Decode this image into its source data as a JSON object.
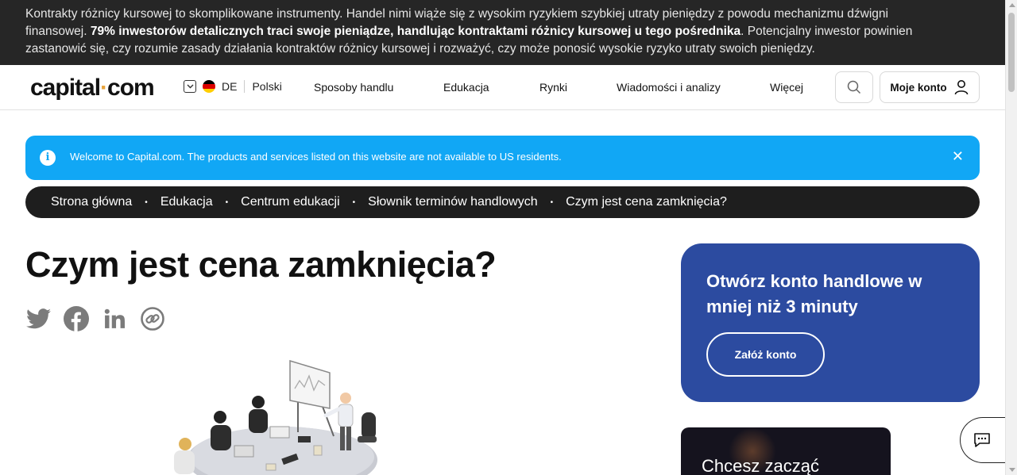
{
  "risk_banner": {
    "text_before": "Kontrakty różnicy kursowej to skomplikowane instrumenty. Handel nimi wiąże się z wysokim ryzykiem szybkiej utraty pieniędzy z powodu mechanizmu dźwigni finansowej. ",
    "text_bold": "79% inwestorów detalicznych traci swoje pieniądze, handlując kontraktami różnicy kursowej u tego pośrednika",
    "text_after": ". Potencjalny inwestor powinien zastanowić się, czy rozumie zasady działania kontraktów różnicy kursowej i rozważyć, czy może ponosić wysokie ryzyko utraty swoich pieniędzy."
  },
  "header": {
    "logo_part1": "capital",
    "logo_dot": "·",
    "logo_part2": "com",
    "region_code": "DE",
    "language": "Polski",
    "nav": [
      "Sposoby handlu",
      "Edukacja",
      "Rynki",
      "Wiadomości i analizy",
      "Więcej"
    ],
    "account_label": "Moje konto",
    "icons": {
      "search": "search-icon",
      "user": "user-icon",
      "chevron": "chevron-down-icon",
      "flag": "germany-flag-icon"
    }
  },
  "notice": {
    "text": "Welcome to Capital.com. The products and services listed on this website are not available to US residents.",
    "info_glyph": "i",
    "close_glyph": "✕",
    "color": "#11a7f5"
  },
  "breadcrumb": [
    "Strona główna",
    "Edukacja",
    "Centrum edukacji",
    "Słownik terminów handlowych",
    "Czym jest cena zamknięcia?"
  ],
  "breadcrumb_separator": "•",
  "page": {
    "title": "Czym jest cena zamknięcia?",
    "share_icons": [
      "twitter-icon",
      "facebook-icon",
      "linkedin-icon",
      "copy-link-icon"
    ]
  },
  "promo": {
    "title": "Otwórz konto handlowe w mniej niż 3 minuty",
    "button": "Załóż konto",
    "color": "#2c4ba0"
  },
  "promo2": {
    "text": "Chcesz zacząć"
  },
  "colors": {
    "risk_bg": "#262626",
    "logo_dot": "#e8a23a",
    "breadcrumb_bg": "#1e1e1e"
  }
}
